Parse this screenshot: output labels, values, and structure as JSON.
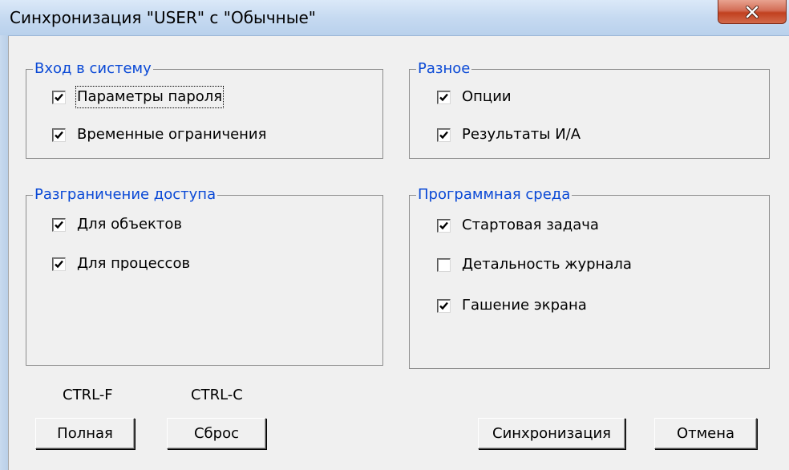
{
  "window": {
    "title": "Синхронизация \"USER\" с \"Обычные\""
  },
  "groups": {
    "login": {
      "title": "Вход в систему",
      "items": [
        {
          "label": "Параметры пароля",
          "checked": true
        },
        {
          "label": "Временные ограничения",
          "checked": true
        }
      ]
    },
    "misc": {
      "title": "Разное",
      "items": [
        {
          "label": "Опции",
          "checked": true
        },
        {
          "label": "Результаты И/А",
          "checked": true
        }
      ]
    },
    "access": {
      "title": "Разграничение доступа",
      "items": [
        {
          "label": "Для объектов",
          "checked": true
        },
        {
          "label": "Для процессов",
          "checked": true
        }
      ]
    },
    "env": {
      "title": "Программная среда",
      "items": [
        {
          "label": "Стартовая задача",
          "checked": true
        },
        {
          "label": "Детальность журнала",
          "checked": false
        },
        {
          "label": "Гашение экрана",
          "checked": true
        }
      ]
    }
  },
  "shortcuts": {
    "full": "CTRL-F",
    "reset": "CTRL-C"
  },
  "buttons": {
    "full": "Полная",
    "reset": "Сброс",
    "sync": "Синхронизация",
    "cancel": "Отмена"
  },
  "colors": {
    "group_title": "#0a49d6",
    "dialog_bg": "#f0f0f0",
    "close_button": "#c1401f"
  },
  "icons": {
    "close": "close-x-icon",
    "check": "checkmark-icon"
  }
}
